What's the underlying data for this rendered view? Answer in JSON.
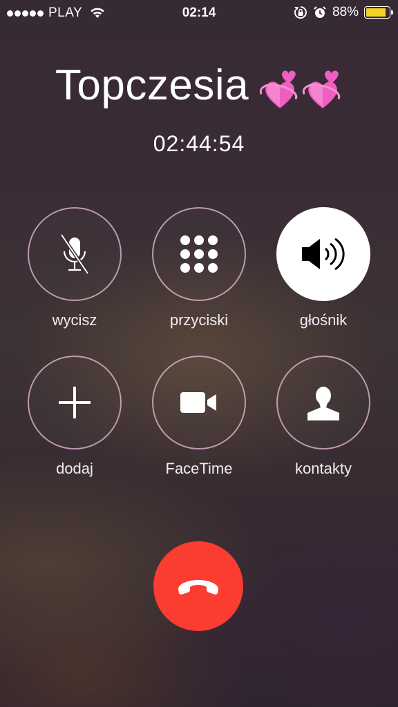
{
  "status_bar": {
    "carrier": "PLAY",
    "time": "02:14",
    "battery_percent": "88%",
    "battery_level": 0.88,
    "icons": [
      "signal-dots",
      "wifi-icon",
      "rotation-lock-icon",
      "alarm-icon",
      "battery-icon"
    ]
  },
  "call": {
    "caller_name": "Topczesia",
    "caller_emoji_icons": [
      "revolving-hearts-icon",
      "revolving-hearts-icon"
    ],
    "duration": "02:44:54"
  },
  "controls": [
    {
      "id": "mute",
      "label": "wycisz",
      "icon": "mic-muted-icon",
      "active": false
    },
    {
      "id": "keypad",
      "label": "przyciski",
      "icon": "keypad-icon",
      "active": false
    },
    {
      "id": "speaker",
      "label": "głośnik",
      "icon": "speaker-icon",
      "active": true
    },
    {
      "id": "add",
      "label": "dodaj",
      "icon": "plus-icon",
      "active": false
    },
    {
      "id": "facetime",
      "label": "FaceTime",
      "icon": "video-camera-icon",
      "active": false
    },
    {
      "id": "contacts",
      "label": "kontakty",
      "icon": "contact-silhouette-icon",
      "active": false
    }
  ],
  "end_call": {
    "icon": "phone-hangup-icon"
  },
  "colors": {
    "end_call": "#fb3c30",
    "battery_fill": "#f5d223",
    "button_ring": "#e2b6d6",
    "active_button_bg": "#ffffff"
  }
}
